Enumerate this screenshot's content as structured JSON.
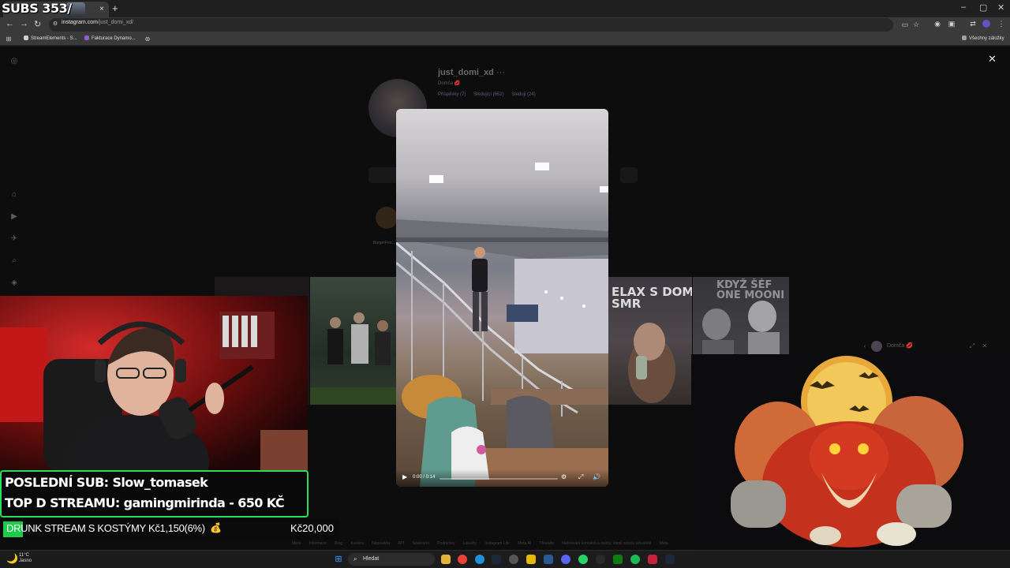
{
  "stream": {
    "title": "SUBS 353/",
    "last_sub": "POSLEDNÍ SUB: Slow_tomasek",
    "top_donor": "TOP D STREAMU: gamingmirinda - 650 KČ",
    "goal": {
      "label": "DRUNK STREAM S KOSTÝMY Kč1,150(6%)",
      "target": "Kč20,000",
      "progress_fraction": 0.06
    }
  },
  "browser": {
    "tab_close": "×",
    "new_tab": "+",
    "url_host": "instagram.com",
    "url_path": "/just_domi_xd/",
    "bookmarks": [
      {
        "label": "StreamElements - S...",
        "color": "#cfcfcf"
      },
      {
        "label": "Fakturace Dynamo...",
        "color": "#8e5cd9"
      }
    ],
    "all_bookmarks": "Všechny záložky",
    "window_controls": [
      "–",
      "▢",
      "✕"
    ]
  },
  "instagram": {
    "username": "just_domi_xd",
    "more": "···",
    "display_name": "Domča 💋",
    "stats": [
      "Příspěvky (7)",
      "Sledující (652)",
      "Sleduji (24)"
    ],
    "highlight_label": "BurgerFes...",
    "close": "✕",
    "tiles": [
      {
        "text": ""
      },
      {
        "text": ""
      },
      {
        "text": "ELAX S DOMI\nSMR"
      },
      {
        "text": "KDYŽ ŠÉF\nONE MOONI"
      }
    ],
    "mini_chat_name": "Domča 💋",
    "footer_links": [
      "Meta",
      "Informace",
      "Blog",
      "Kariéra",
      "Nápověda",
      "API",
      "Soukromí",
      "Podmínky",
      "Lokality",
      "Instagram Lite",
      "Meta AI",
      "Threads",
      "Nahrávání kontaktů a osoby, které nejsou uživatelé",
      "Meta"
    ]
  },
  "reel": {
    "time": "0:00 / 0:14",
    "progress_fraction": 0.0
  },
  "taskbar": {
    "temperature": "11°C",
    "condition": "Jasno",
    "search_label": "Hledat"
  },
  "icons": {
    "back": "back-arrow-icon",
    "forward": "forward-arrow-icon",
    "reload": "reload-icon",
    "star": "bookmark-star-icon",
    "play": "play-icon",
    "settings": "gear-icon",
    "fullscreen": "fullscreen-icon",
    "volume": "volume-icon"
  }
}
